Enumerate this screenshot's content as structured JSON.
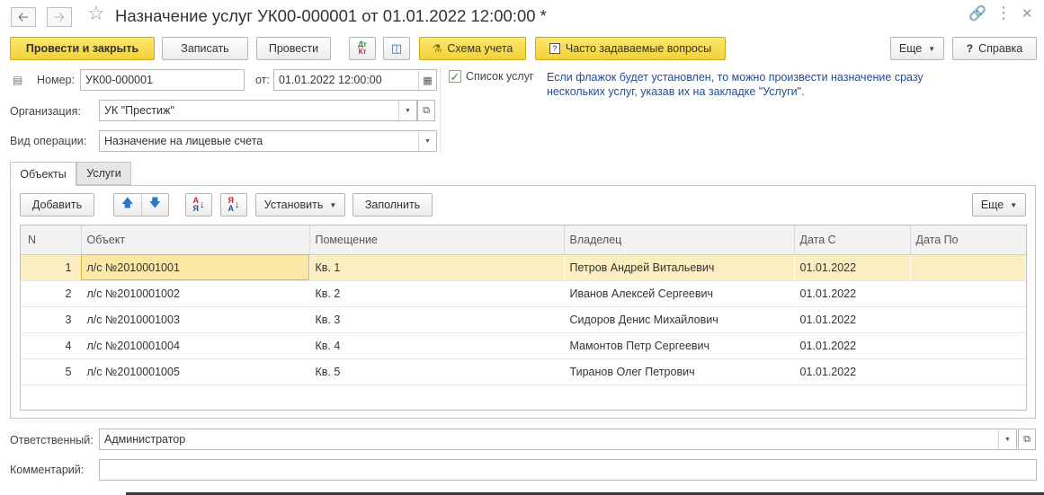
{
  "window": {
    "title": "Назначение услуг УК00-000001 от 01.01.2022 12:00:00 *"
  },
  "toolbar": {
    "post_close": "Провести и закрыть",
    "save": "Записать",
    "post": "Провести",
    "dtkt": "Дт Кт",
    "scheme": "Схема учета",
    "faq": "Часто задаваемые вопросы",
    "more": "Еще",
    "help": "Справка"
  },
  "form": {
    "number_label": "Номер:",
    "number_value": "УК00-000001",
    "date_label": "от:",
    "date_value": "01.01.2022 12:00:00",
    "org_label": "Организация:",
    "org_value": "УК \"Престиж\"",
    "optype_label": "Вид операции:",
    "optype_value": "Назначение на лицевые счета",
    "services_list_label": "Список услуг",
    "services_list_checked": true,
    "hint": "Если флажок будет установлен, то можно произвести назначение сразу нескольких услуг, указав их на закладке \"Услуги\"."
  },
  "tabs": [
    {
      "label": "Объекты",
      "active": true
    },
    {
      "label": "Услуги",
      "active": false
    }
  ],
  "subtoolbar": {
    "add": "Добавить",
    "set": "Установить",
    "fill": "Заполнить",
    "more": "Еще"
  },
  "table": {
    "columns": [
      "N",
      "Объект",
      "Помещение",
      "Владелец",
      "Дата С",
      "Дата По"
    ],
    "rows": [
      {
        "n": "1",
        "object": "л/с №2010001001",
        "room": "Кв. 1",
        "owner": "Петров Андрей Витальевич",
        "date_from": "01.01.2022",
        "date_to": ""
      },
      {
        "n": "2",
        "object": "л/с №2010001002",
        "room": "Кв. 2",
        "owner": "Иванов Алексей Сергеевич",
        "date_from": "01.01.2022",
        "date_to": ""
      },
      {
        "n": "3",
        "object": "л/с №2010001003",
        "room": "Кв. 3",
        "owner": "Сидоров Денис Михайлович",
        "date_from": "01.01.2022",
        "date_to": ""
      },
      {
        "n": "4",
        "object": "л/с №2010001004",
        "room": "Кв. 4",
        "owner": "Мамонтов Петр Сергеевич",
        "date_from": "01.01.2022",
        "date_to": ""
      },
      {
        "n": "5",
        "object": "л/с №2010001005",
        "room": "Кв. 5",
        "owner": "Тиранов Олег Петрович",
        "date_from": "01.01.2022",
        "date_to": ""
      }
    ]
  },
  "footer": {
    "responsible_label": "Ответственный:",
    "responsible_value": "Администратор",
    "comment_label": "Комментарий:",
    "comment_value": ""
  }
}
